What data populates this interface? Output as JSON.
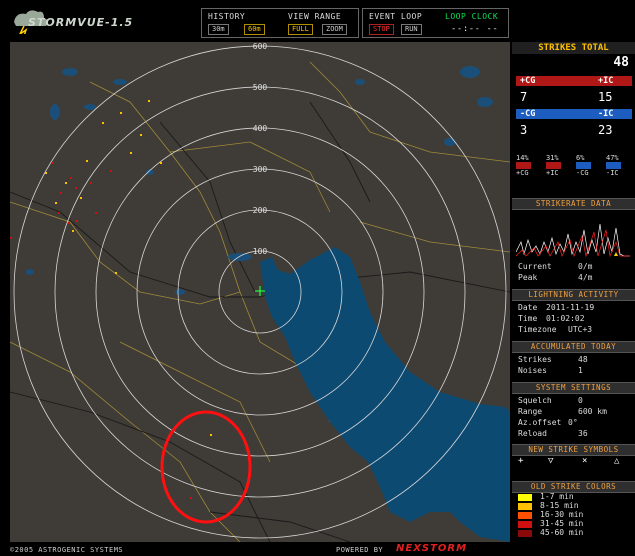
{
  "app": {
    "title": "STORMVUE-1.5",
    "copyright": "©2005 ASTROGENIC SYSTEMS",
    "powered_by": "POWERED BY",
    "brand": "NEXSTORM"
  },
  "history": {
    "label": "HISTORY",
    "opt1": "30m",
    "opt2": "60m",
    "selected": "60m"
  },
  "view_range": {
    "label": "VIEW RANGE",
    "opt1": "FULL",
    "opt2": "ZOOM",
    "selected": "FULL"
  },
  "event_loop": {
    "label": "EVENT LOOP",
    "stop": "STOP",
    "run": "RUN"
  },
  "loop_clock": {
    "label": "LOOP CLOCK",
    "value": "--:-- --"
  },
  "range_rings": [
    "600",
    "500",
    "400",
    "300",
    "200",
    "100"
  ],
  "strikes_total": {
    "label": "STRIKES TOTAL",
    "value": "48"
  },
  "counts": {
    "pcg_label": "+CG",
    "pic_label": "+IC",
    "pcg": "7",
    "pic": "15",
    "ncg_label": "-CG",
    "nic_label": "-IC",
    "ncg": "3",
    "nic": "23"
  },
  "percent_bars": [
    {
      "pct": "14%",
      "label": "+CG",
      "fraction": 0.14,
      "color": "#b01818"
    },
    {
      "pct": "31%",
      "label": "+IC",
      "fraction": 0.31,
      "color": "#b01818"
    },
    {
      "pct": "6%",
      "label": "-CG",
      "fraction": 0.06,
      "color": "#1e5dc0"
    },
    {
      "pct": "47%",
      "label": "-IC",
      "fraction": 0.47,
      "color": "#1e5dc0"
    }
  ],
  "strikerate": {
    "header": "STRIKERATE DATA",
    "current_label": "Current",
    "current": "0/m",
    "peak_label": "Peak",
    "peak": "4/m"
  },
  "lightning": {
    "header": "LIGHTNING ACTIVITY",
    "date_label": "Date",
    "date": "2011-11-19",
    "time_label": "Time",
    "time": "01:02:02",
    "tz_label": "Timezone",
    "tz": "UTC+3"
  },
  "accumulated": {
    "header": "ACCUMULATED TODAY",
    "strikes_label": "Strikes",
    "strikes": "48",
    "noises_label": "Noises",
    "noises": "1"
  },
  "settings": {
    "header": "SYSTEM SETTINGS",
    "squelch_label": "Squelch",
    "squelch": "0",
    "range_label": "Range",
    "range": "600 km",
    "az_label": "Az.offset",
    "az": "0°",
    "reload_label": "Reload",
    "reload": "36"
  },
  "symbols": {
    "header": "NEW STRIKE SYMBOLS",
    "items": [
      "+",
      "▽",
      "×",
      "△"
    ]
  },
  "old_colors": {
    "header": "OLD STRIKE COLORS",
    "items": [
      {
        "label": "1-7 min",
        "color": "#ffff00"
      },
      {
        "label": "8-15 min",
        "color": "#ffc000"
      },
      {
        "label": "16-30 min",
        "color": "#ff5000"
      },
      {
        "label": "31-45 min",
        "color": "#d01010"
      },
      {
        "label": "45-60 min",
        "color": "#8a0a0a"
      }
    ]
  }
}
